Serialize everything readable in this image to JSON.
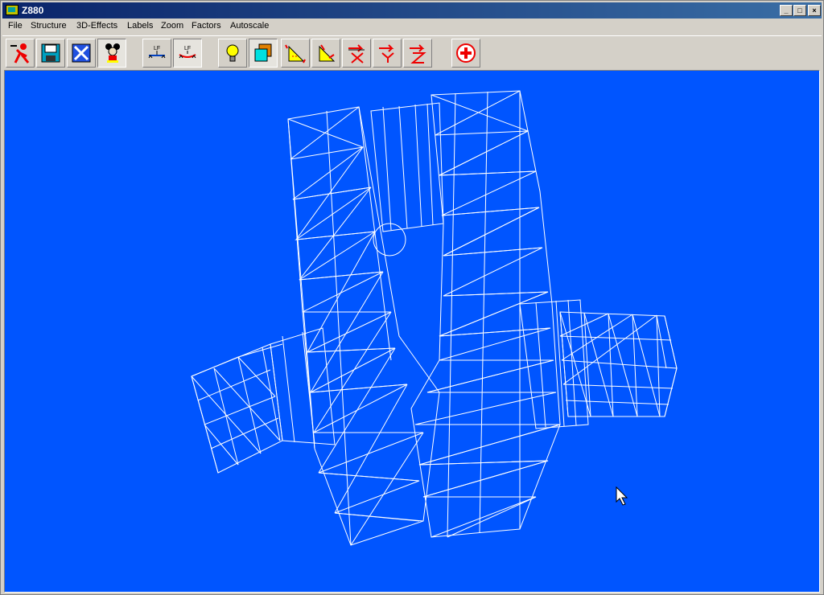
{
  "window": {
    "title": "Z880",
    "minimize_icon": "minimize-icon",
    "maximize_icon": "maximize-icon",
    "close_icon": "close-icon"
  },
  "menu": [
    "File",
    "Structure",
    "3D-Effects",
    "Labels",
    "Zoom",
    "Factors",
    "Autoscale"
  ],
  "toolbar": {
    "items": [
      "exit-runner-icon",
      "save-disk-icon",
      "close-x-icon",
      "mascot-icon",
      "load-case-1-icon",
      "load-case-2-icon",
      "lightbulb-icon",
      "boxes-icon",
      "rotate-xy-icon",
      "rotate-y-icon",
      "rotate-x-icon",
      "rotate-y2-icon",
      "rotate-z-icon",
      "plus-red-icon"
    ],
    "small_label": "LF"
  },
  "viewport": {
    "background": "#0055ff",
    "mesh_color": "#ffffff",
    "content": "wireframe crankshaft mesh",
    "cursor_icon": "mouse-cursor-icon"
  }
}
